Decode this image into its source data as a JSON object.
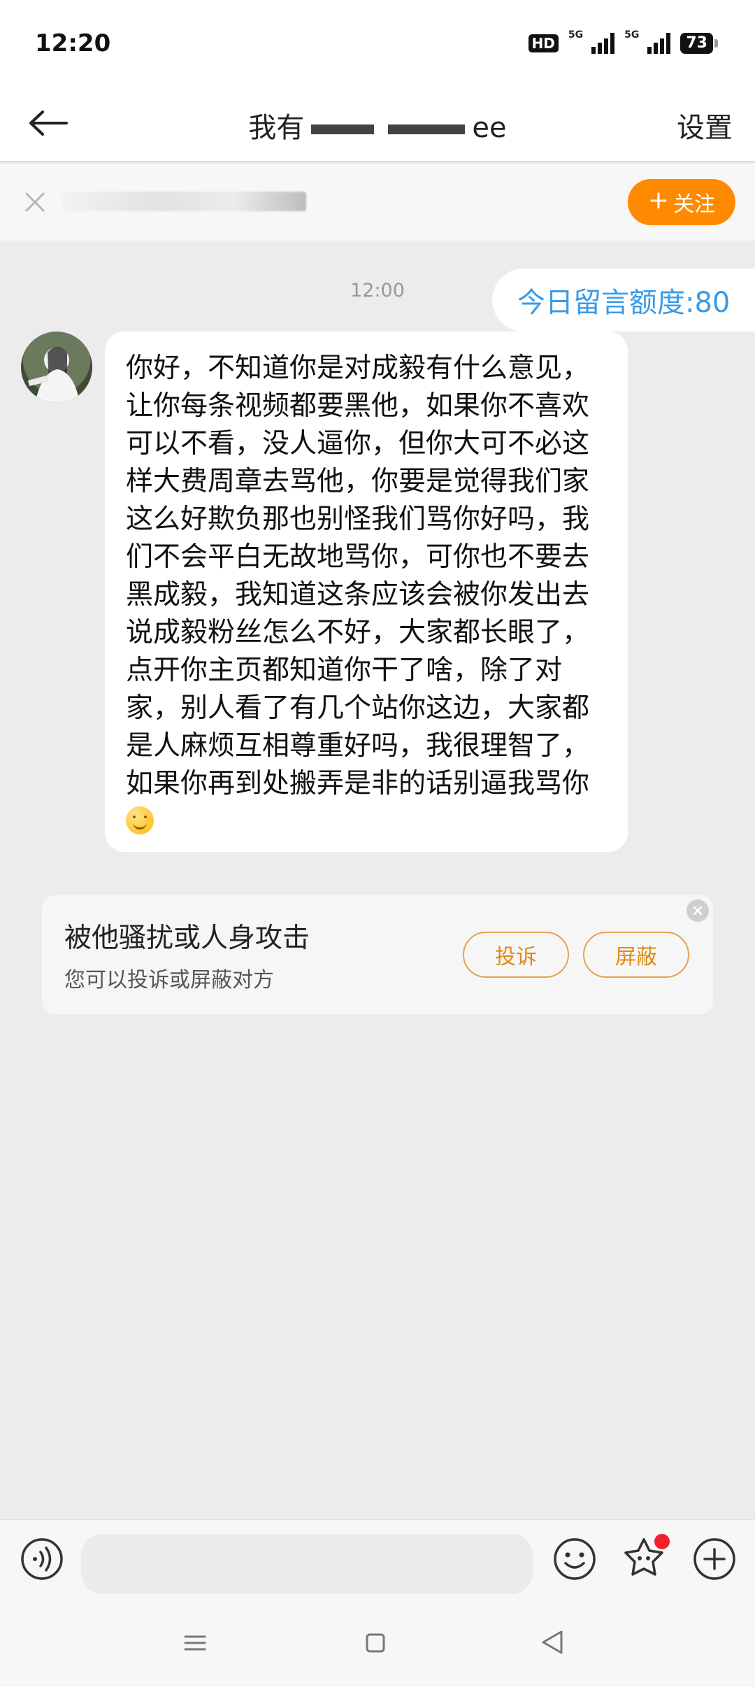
{
  "status_bar": {
    "time": "12:20",
    "hd_label": "HD",
    "signal_1_label": "5G",
    "signal_2_label": "5G",
    "battery": "73"
  },
  "header": {
    "title_start": "我有",
    "title_end": "ee",
    "settings_label": "设置"
  },
  "follow_bar": {
    "follow_label": "关注"
  },
  "chat": {
    "timestamp": "12:00",
    "quota_text": "今日留言额度:80",
    "message_text": "你好，不知道你是对成毅有什么意见，让你每条视频都要黑他，如果你不喜欢可以不看，没人逼你，但你大可不必这样大费周章去骂他，你要是觉得我们家这么好欺负那也别怪我们骂你好吗，我们不会平白无故地骂你，可你也不要去黑成毅，我知道这条应该会被你发出去说成毅粉丝怎么不好，大家都长眼了，点开你主页都知道你干了啥，除了对家，别人看了有几个站你这边，大家都是人麻烦互相尊重好吗，我很理智了，如果你再到处搬弄是非的话别逼我骂你"
  },
  "report_card": {
    "title": "被他骚扰或人身攻击",
    "subtitle": "您可以投诉或屏蔽对方",
    "report_label": "投诉",
    "block_label": "屏蔽"
  },
  "input_bar": {
    "placeholder": ""
  },
  "colors": {
    "accent_orange": "#ff8a00",
    "quota_blue": "#3b9be6",
    "badge_red": "#f3202c"
  },
  "icons": [
    "back-arrow-icon",
    "close-icon",
    "avatar",
    "voice-icon",
    "emoji-icon",
    "sticker-icon",
    "plus-icon",
    "menu-icon",
    "home-icon",
    "back-triangle-icon"
  ]
}
